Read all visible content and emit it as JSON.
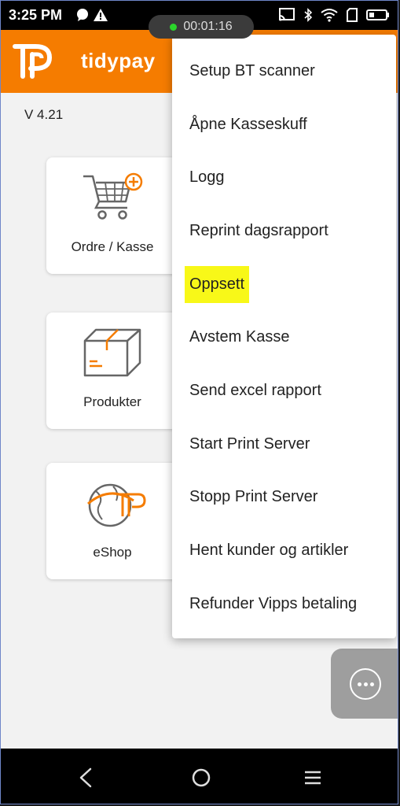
{
  "status_bar": {
    "time": "3:25 PM",
    "recording_timer": "00:01:16",
    "left_icons": [
      "chat-bubble-icon",
      "alert-icon"
    ],
    "right_icons": [
      "cast-icon",
      "bluetooth-icon",
      "wifi-icon",
      "sim-icon",
      "battery-icon"
    ]
  },
  "app_bar": {
    "title": "tidypay",
    "logo": "tidypay-logo"
  },
  "version": "V 4.21",
  "cards": [
    {
      "label": "Ordre / Kasse",
      "icon": "cart-icon"
    },
    {
      "label": "Produkter",
      "icon": "box-icon"
    },
    {
      "label": "eShop",
      "icon": "globe-icon"
    }
  ],
  "menu": {
    "items": [
      {
        "label": "Setup BT scanner"
      },
      {
        "label": "Åpne Kasseskuff"
      },
      {
        "label": "Logg"
      },
      {
        "label": "Reprint dagsrapport"
      },
      {
        "label": "Oppsett",
        "highlighted": true
      },
      {
        "label": "Avstem Kasse"
      },
      {
        "label": "Send excel rapport"
      },
      {
        "label": "Start Print Server"
      },
      {
        "label": "Stopp Print Server"
      },
      {
        "label": "Hent kunder og artikler"
      },
      {
        "label": "Refunder Vipps betaling"
      }
    ]
  },
  "colors": {
    "brand_orange": "#f57c00",
    "highlight": "#f8f818",
    "fab": "#9e9e9e"
  },
  "nav": {
    "buttons": [
      "back-icon",
      "home-icon",
      "recents-icon"
    ]
  }
}
